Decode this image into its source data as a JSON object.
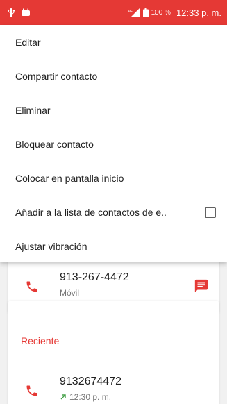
{
  "status_bar": {
    "battery_percent": "100 %",
    "time": "12:33 p. m.",
    "icons": [
      "usb-icon",
      "android-icon",
      "lte-signal-icon",
      "battery-icon"
    ]
  },
  "menu": {
    "items": [
      {
        "label": "Editar"
      },
      {
        "label": "Compartir contacto"
      },
      {
        "label": "Eliminar"
      },
      {
        "label": "Bloquear contacto"
      },
      {
        "label": "Colocar en pantalla inicio"
      },
      {
        "label": "Añadir a la lista de contactos de e..",
        "checkbox": false
      },
      {
        "label": "Ajustar vibración"
      }
    ]
  },
  "contact": {
    "number": "913-267-4472",
    "type": "Móvil"
  },
  "recent": {
    "title": "Reciente",
    "calls": [
      {
        "number": "9132674472",
        "time": "12:30 p. m.",
        "direction": "outgoing"
      }
    ]
  },
  "colors": {
    "accent": "#e53935",
    "outgoing_arrow": "#43a047"
  }
}
